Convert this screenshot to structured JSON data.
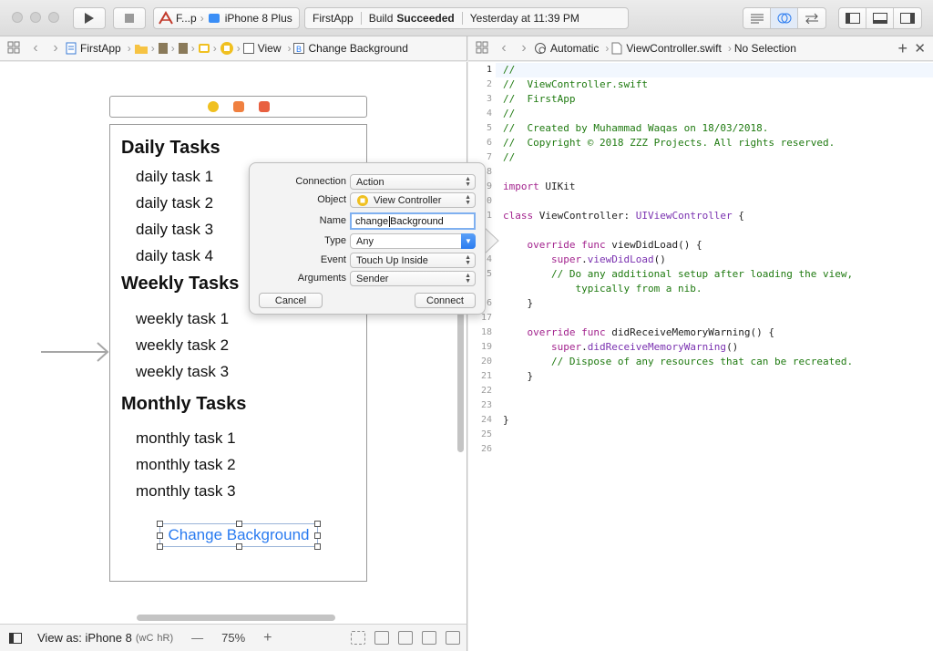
{
  "toolbar": {
    "scheme_app": "F...p",
    "scheme_device": "iPhone 8 Plus",
    "activity_project": "FirstApp",
    "activity_status_prefix": "Build",
    "activity_status": "Succeeded",
    "activity_time": "Yesterday at 11:39 PM"
  },
  "left_jumpbar": {
    "items": [
      "FirstApp",
      "View",
      "Change Background"
    ],
    "icons": [
      "project-icon",
      "folder-icon",
      "storyboard-icon",
      "storyboard-icon",
      "scene-icon",
      "view-controller-icon",
      "view-icon",
      "button-icon"
    ]
  },
  "right_jumpbar": {
    "mode": "Automatic",
    "file": "ViewController.swift",
    "selection": "No Selection"
  },
  "scene": {
    "section1_title": "Daily Tasks",
    "section1_items": [
      "daily task 1",
      "daily task 2",
      "daily task 3",
      "daily task 4"
    ],
    "section2_title": "Weekly Tasks",
    "section2_items": [
      "weekly task 1",
      "weekly task 2",
      "weekly task 3"
    ],
    "section3_title": "Monthly Tasks",
    "section3_items": [
      "monthly task 1",
      "monthly task 2",
      "monthly task 3"
    ],
    "button_label": "Change Background"
  },
  "popover": {
    "connection_label": "Connection",
    "connection_value": "Action",
    "object_label": "Object",
    "object_value": "View Controller",
    "name_label": "Name",
    "name_value_before_caret": "change",
    "name_value_after_caret": "Background",
    "type_label": "Type",
    "type_value": "Any",
    "event_label": "Event",
    "event_value": "Touch Up Inside",
    "arguments_label": "Arguments",
    "arguments_value": "Sender",
    "cancel_label": "Cancel",
    "connect_label": "Connect"
  },
  "bottom_bar": {
    "view_as": "View as: iPhone 8",
    "size_class_w": "wC",
    "size_class_h": "hR",
    "zoom_minus": "—",
    "zoom": "75%",
    "zoom_plus": "+"
  },
  "editor": {
    "lines": [
      {
        "n": "1",
        "text": "//",
        "cls": "cmt"
      },
      {
        "n": "2",
        "text": "//  ViewController.swift",
        "cls": "cmt"
      },
      {
        "n": "3",
        "text": "//  FirstApp",
        "cls": "cmt"
      },
      {
        "n": "4",
        "text": "//",
        "cls": "cmt"
      },
      {
        "n": "5",
        "text": "//  Created by Muhammad Waqas on 18/03/2018.",
        "cls": "cmt"
      },
      {
        "n": "6",
        "text": "//  Copyright © 2018 ZZZ Projects. All rights reserved.",
        "cls": "cmt"
      },
      {
        "n": "7",
        "text": "//",
        "cls": "cmt"
      },
      {
        "n": "8",
        "text": "",
        "cls": ""
      },
      {
        "n": "9",
        "text": "import UIKit",
        "cls": "import"
      },
      {
        "n": "10",
        "text": "",
        "cls": ""
      },
      {
        "n": "11",
        "text": "class ViewController: UIViewController {",
        "cls": "class"
      },
      {
        "n": "12",
        "text": "",
        "cls": ""
      },
      {
        "n": "13",
        "text": "    override func viewDidLoad() {",
        "cls": "func"
      },
      {
        "n": "14",
        "text": "        super.viewDidLoad()",
        "cls": "super"
      },
      {
        "n": "15",
        "text": "        // Do any additional setup after loading the view,",
        "cls": "cmt"
      },
      {
        "n": "15b",
        "text": "            typically from a nib.",
        "cls": "cmt"
      },
      {
        "n": "16",
        "text": "    }",
        "cls": ""
      },
      {
        "n": "17",
        "text": "",
        "cls": ""
      },
      {
        "n": "18",
        "text": "    override func didReceiveMemoryWarning() {",
        "cls": "func"
      },
      {
        "n": "19",
        "text": "        super.didReceiveMemoryWarning()",
        "cls": "super"
      },
      {
        "n": "20",
        "text": "        // Dispose of any resources that can be recreated.",
        "cls": "cmt"
      },
      {
        "n": "21",
        "text": "    }",
        "cls": ""
      },
      {
        "n": "22",
        "text": "",
        "cls": ""
      },
      {
        "n": "23",
        "text": "",
        "cls": ""
      },
      {
        "n": "24",
        "text": "}",
        "cls": ""
      },
      {
        "n": "25",
        "text": "",
        "cls": ""
      },
      {
        "n": "26",
        "text": "",
        "cls": ""
      }
    ],
    "visible_line_numbers": [
      "1",
      "2",
      "3",
      "4",
      "5",
      "6",
      "7",
      "8",
      "9",
      "0",
      "1",
      "",
      "",
      "4",
      "5",
      "",
      "6",
      "17",
      "18",
      "19",
      "20",
      "21",
      "22",
      "23",
      "24",
      "25",
      "26"
    ]
  },
  "colors": {
    "comment": "#1f7a10",
    "keyword": "#a3248e",
    "type": "#7a31b0",
    "accent": "#2a7bf0"
  }
}
